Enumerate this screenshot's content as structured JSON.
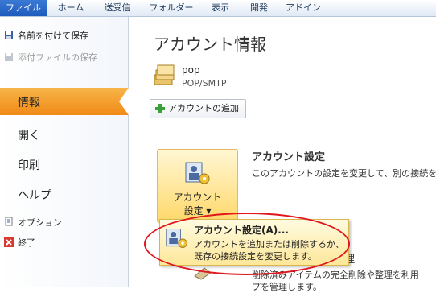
{
  "ribbon": {
    "tabs": [
      "ファイル",
      "ホーム",
      "送受信",
      "フォルダー",
      "表示",
      "開発",
      "アドイン"
    ]
  },
  "left": {
    "save_as": "名前を付けて保存",
    "save_attachments": "添付ファイルの保存",
    "info": "情報",
    "open": "開く",
    "print": "印刷",
    "help": "ヘルプ",
    "options": "オプション",
    "exit": "終了"
  },
  "main": {
    "title": "アカウント情報",
    "account_name": "pop",
    "account_type": "POP/SMTP",
    "add_account": "アカウントの追加",
    "settings_button_line1": "アカウント",
    "settings_button_line2": "設定 ▾",
    "settings_title": "アカウント設定",
    "settings_desc": "このアカウントの設定を変更して、別の接続を",
    "behind_text_1": "理",
    "behind_text_2": "削除済みアイテムの完全削除や整理を利用",
    "behind_text_3": "プを管理します。"
  },
  "dropdown": {
    "item_title": "アカウント設定(A)...",
    "item_desc_1": "アカウントを追加または削除するか、",
    "item_desc_2": "既存の接続設定を変更します。"
  },
  "colors": {
    "file_tab": "#1e5bbd",
    "active_nav": "#f08a17",
    "highlight_ellipse": "#e0171d"
  }
}
